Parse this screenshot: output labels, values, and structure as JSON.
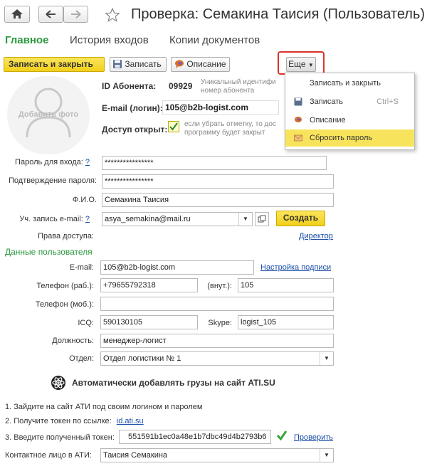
{
  "window": {
    "title": "Проверка: Семакина Таисия (Пользователь)"
  },
  "tabs": [
    {
      "label": "Главное"
    },
    {
      "label": "История входов"
    },
    {
      "label": "Копии документов"
    }
  ],
  "toolbar": {
    "save_close": "Записать и закрыть",
    "save": "Записать",
    "description": "Описание",
    "more": "Еще"
  },
  "more_menu": {
    "items": [
      {
        "label": "Записать и закрыть",
        "shortcut": ""
      },
      {
        "label": "Записать",
        "shortcut": "Ctrl+S"
      },
      {
        "label": "Описание",
        "shortcut": ""
      },
      {
        "label": "Сбросить пароль",
        "shortcut": ""
      }
    ]
  },
  "photo": {
    "label": "Добавить фото"
  },
  "account": {
    "id_label": "ID Абонента:",
    "id_value": "09929",
    "id_hint": "Уникальный идентифи номер абонента",
    "email_label": "E-mail (логин):",
    "email_value": "105@b2b-logist.com",
    "access_label": "Доступ открыт:",
    "access_hint": "если убрать отметку, то дос программу будет закрыт"
  },
  "form": {
    "password_label": "Пароль для входа:",
    "password_value": "****************",
    "confirm_label": "Подтверждение пароля:",
    "confirm_value": "****************",
    "fio_label": "Ф.И.О.",
    "fio_value": "Семакина Таисия",
    "email_account_label": "Уч. запись e-mail:",
    "email_account_value": "asya_semakina@mail.ru",
    "create_button": "Создать",
    "rights_label": "Права доступа:",
    "rights_value": "Директор",
    "help_mark": "?"
  },
  "user_data": {
    "section_title": "Данные пользователя",
    "email_label": "E-mail:",
    "email_value": "105@b2b-logist.com",
    "signature_link": "Настройка подписи",
    "phone_work_label": "Телефон (раб.):",
    "phone_work_value": "+79655792318",
    "ext_label": "(внут.):",
    "ext_value": "105",
    "phone_mobile_label": "Телефон (моб.):",
    "phone_mobile_value": "",
    "icq_label": "ICQ:",
    "icq_value": "590130105",
    "skype_label": "Skype:",
    "skype_value": "logist_105",
    "position_label": "Должность:",
    "position_value": "менеджер-логист",
    "dept_label": "Отдел:",
    "dept_value": "Отдел логистики № 1"
  },
  "ati": {
    "title": "Автоматически добавлять грузы на сайт ATI.SU",
    "step1": "1. Зайдите на сайт АТИ под своим логином и паролем",
    "step2": "2. Получите токен по ссылке:",
    "step2_link": "id.ati.su",
    "step3": "3. Введите полученный токен:",
    "token_value": "551591b1ec0a48e1b7dbc49d4b2793b6",
    "check_link": "Проверить",
    "contact_label": "Контактное лицо в АТИ:",
    "contact_value": "Таисия Семакина"
  },
  "colors": {
    "accent_green": "#2b9a3d",
    "link_blue": "#1a4fa8",
    "highlight_red": "#d9342b",
    "menu_highlight": "#f8e45c",
    "button_yellow": "#f5d526"
  }
}
